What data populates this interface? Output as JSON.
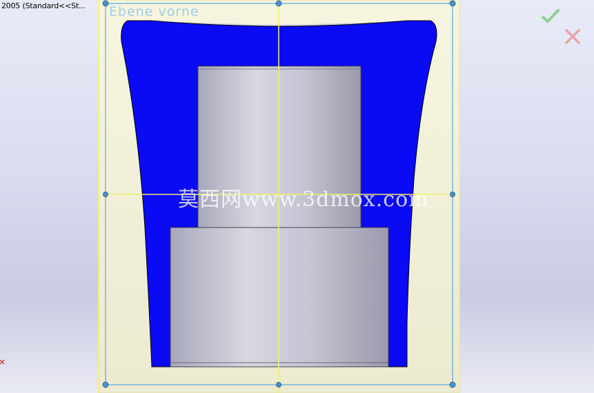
{
  "window": {
    "title": "2005 (Standard<<St..."
  },
  "viewport": {
    "plane_label": "Ebene vorne",
    "watermark": "莫西网www.3dmox.com",
    "confirm_icon": "checkmark-icon",
    "cancel_icon": "x-close-icon"
  },
  "colors": {
    "section_fill": "#0a0af5",
    "plane_outline": "#5aa6dc",
    "crosshair": "#f4f06a",
    "plane_fill": "#efeed8",
    "confirm": "#8fd08f",
    "cancel": "#e8a4a4"
  }
}
